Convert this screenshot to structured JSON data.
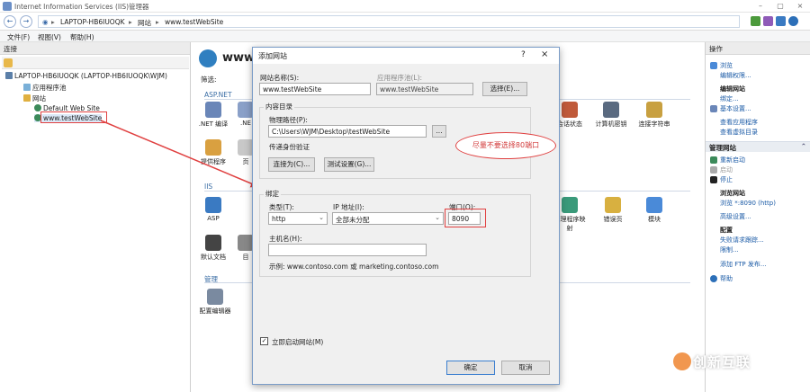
{
  "window": {
    "title": "Internet Information Services (IIS)管理器"
  },
  "address": {
    "crumbs": [
      "LAPTOP-HB6IUOQK",
      "网站",
      "www.testWebSite"
    ]
  },
  "menu": {
    "items": [
      "文件(F)",
      "视图(V)",
      "帮助(H)"
    ]
  },
  "connections": {
    "header": "连接",
    "tree": [
      {
        "label": "LAPTOP-HB6IUOQK (LAPTOP-HB6IUOQK\\WJM)",
        "level": 0
      },
      {
        "label": "应用程序池",
        "level": 1
      },
      {
        "label": "网站",
        "level": 1
      },
      {
        "label": "Default Web Site",
        "level": 2
      },
      {
        "label": "www.testWebSite",
        "level": 2
      }
    ]
  },
  "center": {
    "title": "www.",
    "filter_label": "筛选:",
    "groups": [
      "ASP.NET",
      "IIS",
      "管理"
    ],
    "features_left": [
      ".NET 编译",
      ".NE",
      "提供程序",
      "页",
      "ASP",
      "默认文档",
      "目",
      "配置编辑器"
    ],
    "features_right": [
      "会话状态",
      "计算机密钥",
      "连接字符串",
      "处理程序映射",
      "错误页",
      "模块"
    ]
  },
  "actions": {
    "header": "操作",
    "items_top": [
      "浏览",
      "编辑权限..."
    ],
    "edit_site_header": "编辑网站",
    "edit_site": [
      "绑定...",
      "基本设置...",
      "查看应用程序",
      "查看虚拟目录"
    ],
    "manage_header": "管理网站",
    "manage": [
      "重新启动",
      "启动",
      "停止"
    ],
    "browse_header": "浏览网站",
    "browse": [
      "浏览 *:8090 (http)"
    ],
    "advanced": "高级设置...",
    "config_header": "配置",
    "config": [
      "失败请求跟踪...",
      "限制...",
      "添加 FTP 发布..."
    ],
    "help": "帮助"
  },
  "dialog": {
    "title": "添加网站",
    "help_glyph": "?",
    "close_glyph": "×",
    "site_name_label": "网站名称(S):",
    "site_name_value": "www.testWebSite",
    "app_pool_label": "应用程序池(L):",
    "app_pool_value": "www.testWebSite",
    "select_button": "选择(E)...",
    "content_dir_label": "内容目录",
    "physical_path_label": "物理路径(P):",
    "physical_path_value": "C:\\Users\\WJM\\Desktop\\testWebSite",
    "browse_button": "...",
    "pass_auth_label": "传递身份验证",
    "connect_as_button": "连接为(C)...",
    "test_settings_button": "测试设置(G)...",
    "binding_label": "绑定",
    "type_label": "类型(T):",
    "type_value": "http",
    "ip_label": "IP 地址(I):",
    "ip_value": "全部未分配",
    "port_label": "端口(O):",
    "port_value": "8090",
    "host_label": "主机名(H):",
    "host_value": "",
    "example_text": "示例: www.contoso.com 或 marketing.contoso.com",
    "start_immediately_label": "立即启动网站(M)",
    "ok_button": "确定",
    "cancel_button": "取消"
  },
  "annotation": {
    "note": "尽量不要选择80端口"
  },
  "watermark": {
    "text": "创新互联"
  },
  "colors": {
    "annotation_red": "#e04040",
    "link_blue": "#1a5aa6",
    "group_blue": "#3b6ea5"
  }
}
